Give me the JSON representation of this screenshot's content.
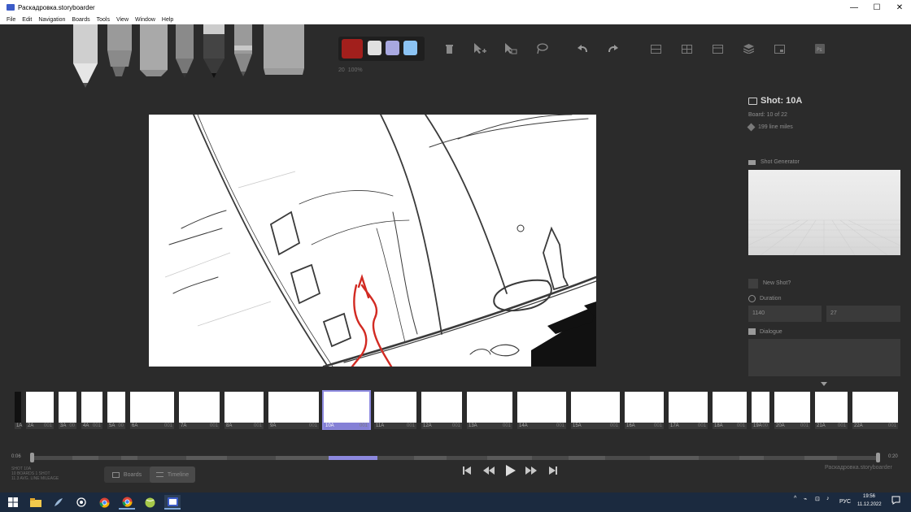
{
  "window": {
    "title": "Раскадровка.storyboarder",
    "minimize": "—",
    "maximize": "☐",
    "close": "✕"
  },
  "menu": [
    "File",
    "Edit",
    "Navigation",
    "Boards",
    "Tools",
    "View",
    "Window",
    "Help"
  ],
  "colors": {
    "active_color": "#a21f1c",
    "palette": [
      "#e0e0e0",
      "#a8a8e0",
      "#8cc4f4"
    ],
    "accent": "#8480d6"
  },
  "brush": {
    "size": "20",
    "opacity": "100%"
  },
  "toolbar_icons": [
    "trash-icon",
    "add-point-icon",
    "move-selection-icon",
    "lasso-icon",
    "undo-icon",
    "redo-icon",
    "layout-1-icon",
    "layout-2-icon",
    "layout-3-icon",
    "layers-icon",
    "shot-icon",
    "photoshop-icon"
  ],
  "shot": {
    "title": "Shot: 10A",
    "board": "Board: 10 of 22",
    "line_miles": "199 line miles"
  },
  "shot_generator": {
    "label": "Shot Generator"
  },
  "new_shot": {
    "label": "New Shot?"
  },
  "duration": {
    "label": "Duration",
    "ms": "1140",
    "frames": "27"
  },
  "dialogue": {
    "label": "Dialogue"
  },
  "boards": [
    {
      "label": "1A",
      "n": ""
    },
    {
      "label": "2A",
      "n": "001"
    },
    {
      "label": "3A",
      "n": "00"
    },
    {
      "label": "4A",
      "n": "001"
    },
    {
      "label": "5A",
      "n": "00"
    },
    {
      "label": "6A",
      "n": "001"
    },
    {
      "label": "7A",
      "n": "001"
    },
    {
      "label": "8A",
      "n": "001"
    },
    {
      "label": "9A",
      "n": "001"
    },
    {
      "label": "10A",
      "n": "001"
    },
    {
      "label": "11A",
      "n": "001"
    },
    {
      "label": "12A",
      "n": "001"
    },
    {
      "label": "13A",
      "n": "001"
    },
    {
      "label": "14A",
      "n": "001"
    },
    {
      "label": "15A",
      "n": "001"
    },
    {
      "label": "16A",
      "n": "001"
    },
    {
      "label": "17A",
      "n": "001"
    },
    {
      "label": "18A",
      "n": "001"
    },
    {
      "label": "19A",
      "n": "00"
    },
    {
      "label": "20A",
      "n": "001"
    },
    {
      "label": "21A",
      "n": "001"
    },
    {
      "label": "22A",
      "n": "001"
    }
  ],
  "timeline": {
    "start": "0:06",
    "end": "0:20"
  },
  "bottom_info": [
    "SHOT 10A",
    "10 BOARDS 1 SHOT",
    "11.3 AVG. LINE MILEAGE"
  ],
  "view": {
    "boards": "Boards",
    "timeline": "Timeline"
  },
  "project_name": "Раскадровка.storyboarder",
  "taskbar": {
    "lang": "РУС",
    "time": "19:56",
    "date": "11.12.2022"
  }
}
